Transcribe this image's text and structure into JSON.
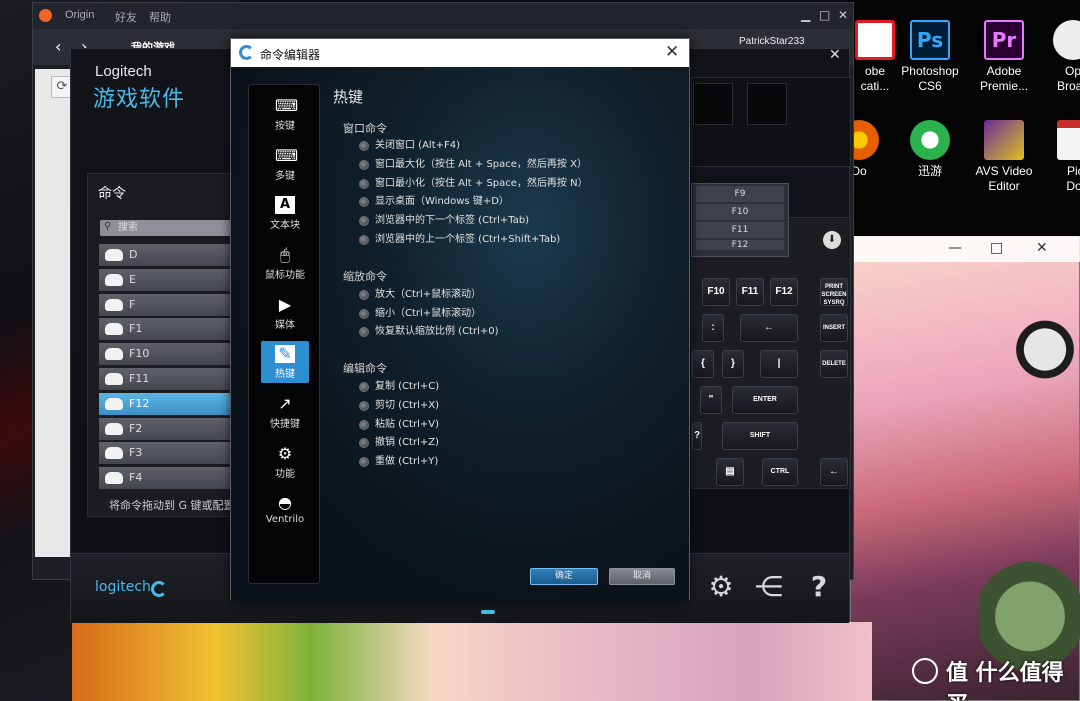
{
  "origin": {
    "app_name": "Origin",
    "menu": [
      "好友",
      "帮助"
    ],
    "nav_text": "我的游戏",
    "username": "PatrickStar233"
  },
  "desktop_icons": [
    {
      "label": "obe\ncati...",
      "icon": "adobe-acrobat-icon",
      "color": "#e21a22"
    },
    {
      "label": "Photoshop\nCS6",
      "icon": "photoshop-icon",
      "color": "#001e36"
    },
    {
      "label": "Adobe\nPremie...",
      "icon": "premiere-icon",
      "color": "#2a0033"
    },
    {
      "label": "Op\nBroad",
      "icon": "obs-icon",
      "color": "#1d1d1d"
    },
    {
      "label": "Do",
      "icon": "firefox-icon",
      "color": "#e66000"
    },
    {
      "label": "迅游",
      "icon": "xunyou-icon",
      "color": "#2bb24c"
    },
    {
      "label": "AVS Video\nEditor",
      "icon": "avs-video-icon",
      "color": "#6b2b9a"
    },
    {
      "label": "Pict\nDoc",
      "icon": "picture-doc-icon",
      "color": "#c9302c"
    }
  ],
  "logitech": {
    "brand": "Logitech",
    "title": "游戏软件",
    "commands_title": "命令",
    "search_placeholder": "搜索",
    "commands": [
      "D",
      "E",
      "F",
      "F1",
      "F10",
      "F11",
      "F12",
      "F2",
      "F3",
      "F4"
    ],
    "active_command": "F12",
    "drag_hint": "将命令拖动到 G 键或配置",
    "logo_text": "logitech",
    "fkeys": [
      "F9",
      "F10",
      "F11",
      "F12"
    ],
    "keys": [
      "F10",
      "F11",
      "F12",
      "PRINT SCREEN SYSRQ",
      "INSERT",
      "DELETE",
      "ENTER",
      "SHIFT",
      "CTRL"
    ]
  },
  "dialog": {
    "title": "命令编辑器",
    "close": "✕",
    "sidebar": [
      {
        "label": "按键",
        "icon": "key-icon"
      },
      {
        "label": "多键",
        "icon": "multikey-icon"
      },
      {
        "label": "文本块",
        "icon": "textblock-icon"
      },
      {
        "label": "鼠标功能",
        "icon": "mouse-icon"
      },
      {
        "label": "媒体",
        "icon": "media-play-icon"
      },
      {
        "label": "热键",
        "icon": "hotkey-icon"
      },
      {
        "label": "快捷键",
        "icon": "shortcut-icon"
      },
      {
        "label": "功能",
        "icon": "function-icon"
      },
      {
        "label": "Ventrilo",
        "icon": "ventrilo-icon"
      }
    ],
    "active_sidebar": "热键",
    "heading": "热键",
    "groups": [
      {
        "title": "窗口命令",
        "options": [
          "关闭窗口 (Alt+F4)",
          "窗口最大化（按住 Alt + Space，然后再按 X）",
          "窗口最小化（按住 Alt + Space，然后再按 N）",
          "显示桌面（Windows 键+D）",
          "浏览器中的下一个标签 (Ctrl+Tab)",
          "浏览器中的上一个标签 (Ctrl+Shift+Tab)"
        ]
      },
      {
        "title": "缩放命令",
        "options": [
          "放大（Ctrl+鼠标滚动）",
          "缩小（Ctrl+鼠标滚动）",
          "恢复默认缩放比例 (Ctrl+0)"
        ]
      },
      {
        "title": "编辑命令",
        "options": [
          "复制 (Ctrl+C)",
          "剪切 (Ctrl+X)",
          "粘贴 (Ctrl+V)",
          "撤销 (Ctrl+Z)",
          "重做 (Ctrl+Y)"
        ]
      }
    ],
    "ok_label": "确定",
    "cancel_label": "取消"
  },
  "watermark": "值 什么值得买",
  "colors": {
    "accent_blue": "#2d8fd2",
    "logitech_blue": "#4ab8e8",
    "origin_orange": "#f26522"
  }
}
